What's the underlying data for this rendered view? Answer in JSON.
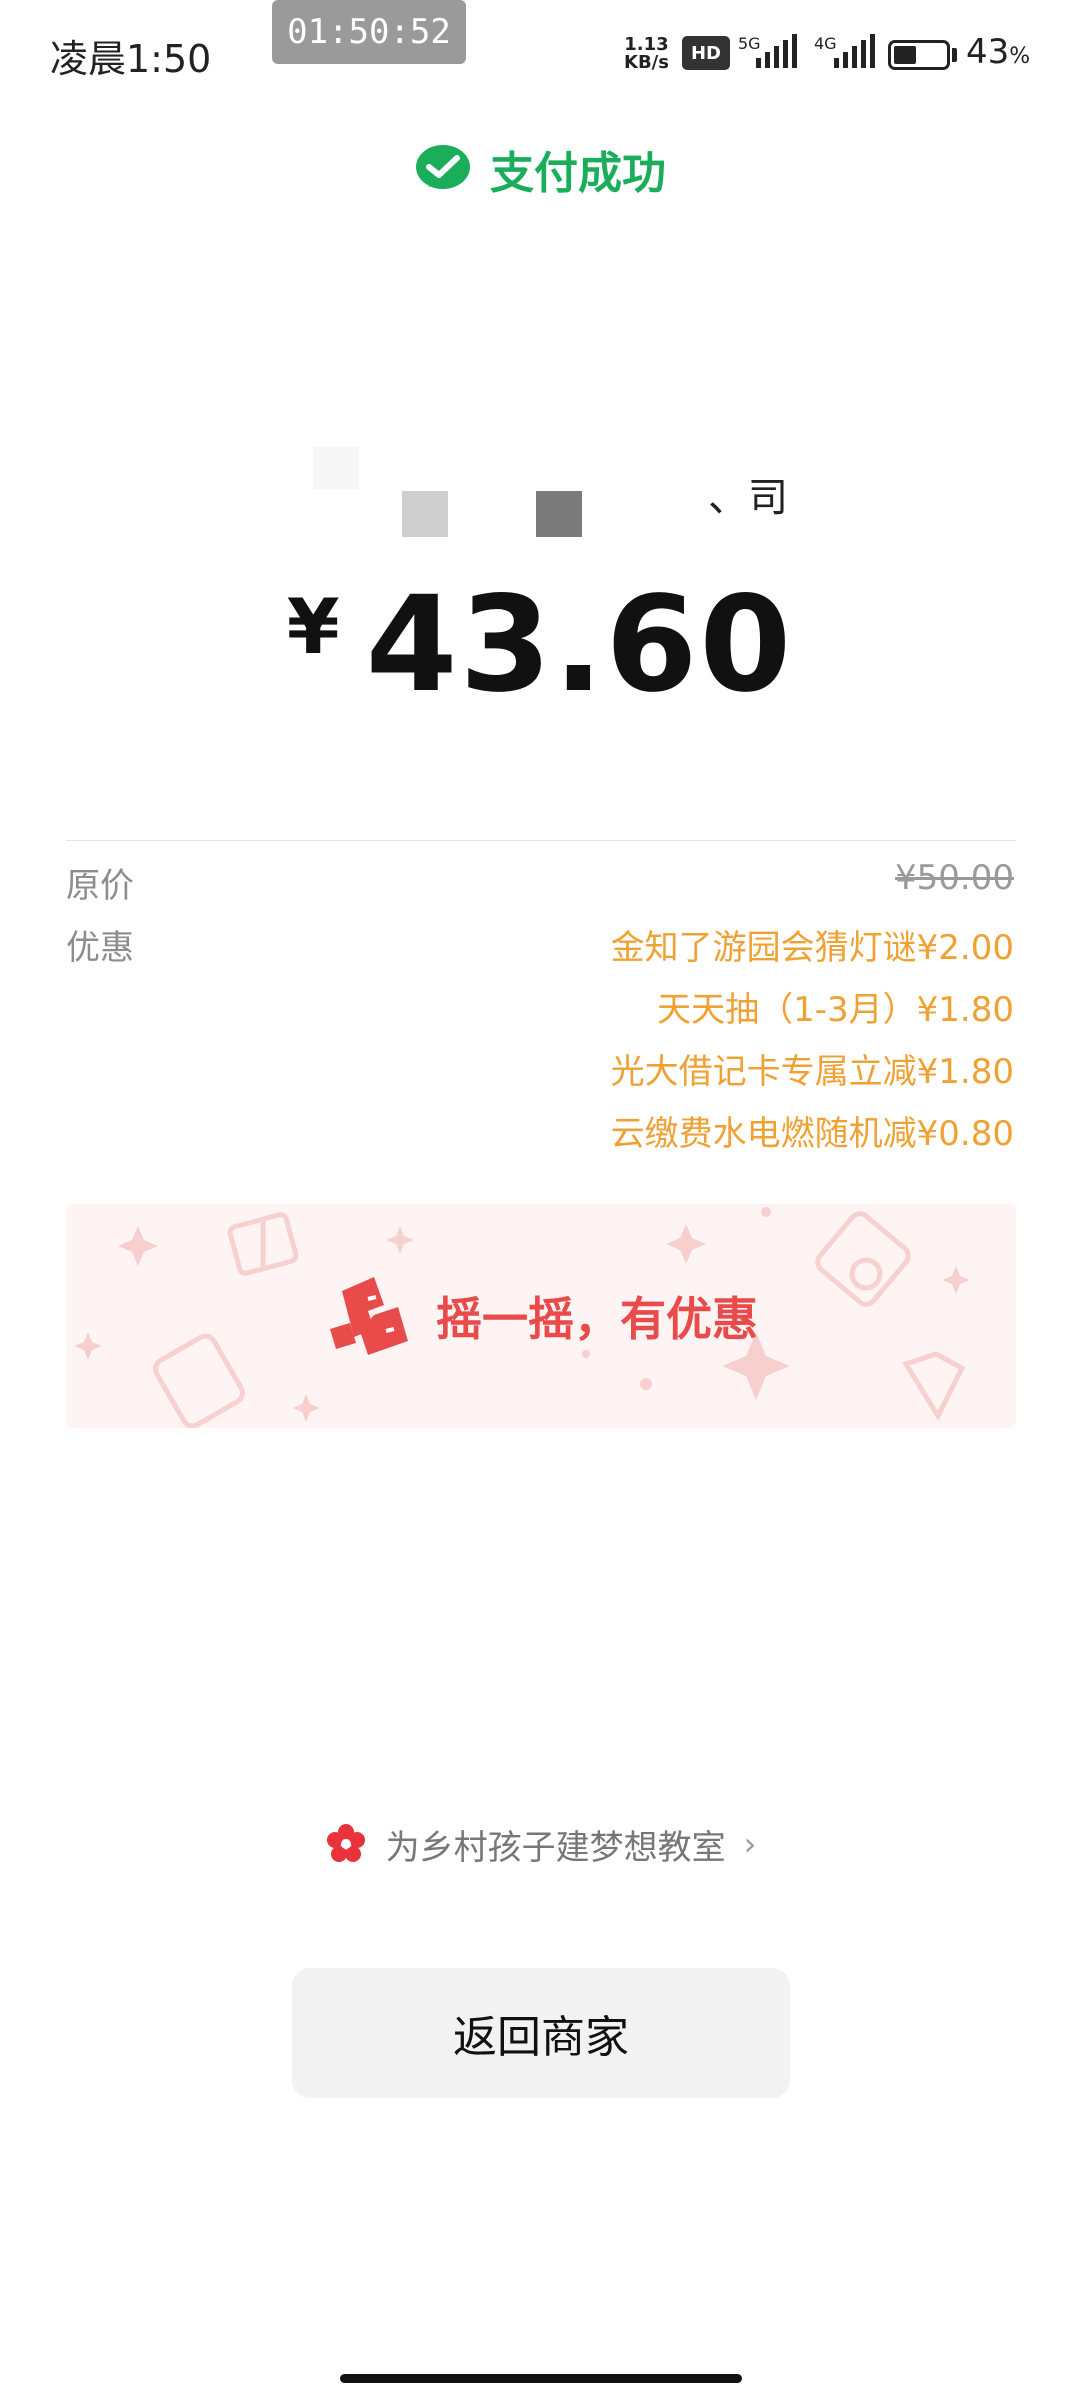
{
  "status_bar": {
    "time": "凌晨1:50",
    "recording_timer": "01:50:52",
    "net_speed_value": "1.13",
    "net_speed_unit": "KB/s",
    "hd_badge": "HD",
    "signal_1_label": "5G",
    "signal_2_label": "4G",
    "battery_percent_value": "43",
    "battery_percent_symbol": "%",
    "battery_level": 0.43
  },
  "header": {
    "title": "支付成功",
    "brand_color": "#1aad5a"
  },
  "merchant": {
    "visible_name_fragment": "、司"
  },
  "payment": {
    "currency_symbol": "¥",
    "amount": "43.60"
  },
  "details": {
    "original_price_label": "原价",
    "original_price_value": "¥50.00",
    "discount_label": "优惠",
    "discounts": [
      "金知了游园会猜灯谜¥2.00",
      "天天抽（1-3月）¥1.80",
      "光大借记卡专属立减¥1.80",
      "云缴费水电燃随机减¥0.80"
    ],
    "discount_color": "#f0a133"
  },
  "promo_banner": {
    "text": "摇一摇，有优惠",
    "icon": "shake-icon",
    "accent_color": "#e94a4a"
  },
  "charity": {
    "text": "为乡村孩子建梦想教室",
    "chevron": "›",
    "icon": "flower-icon"
  },
  "actions": {
    "return_label": "返回商家"
  }
}
